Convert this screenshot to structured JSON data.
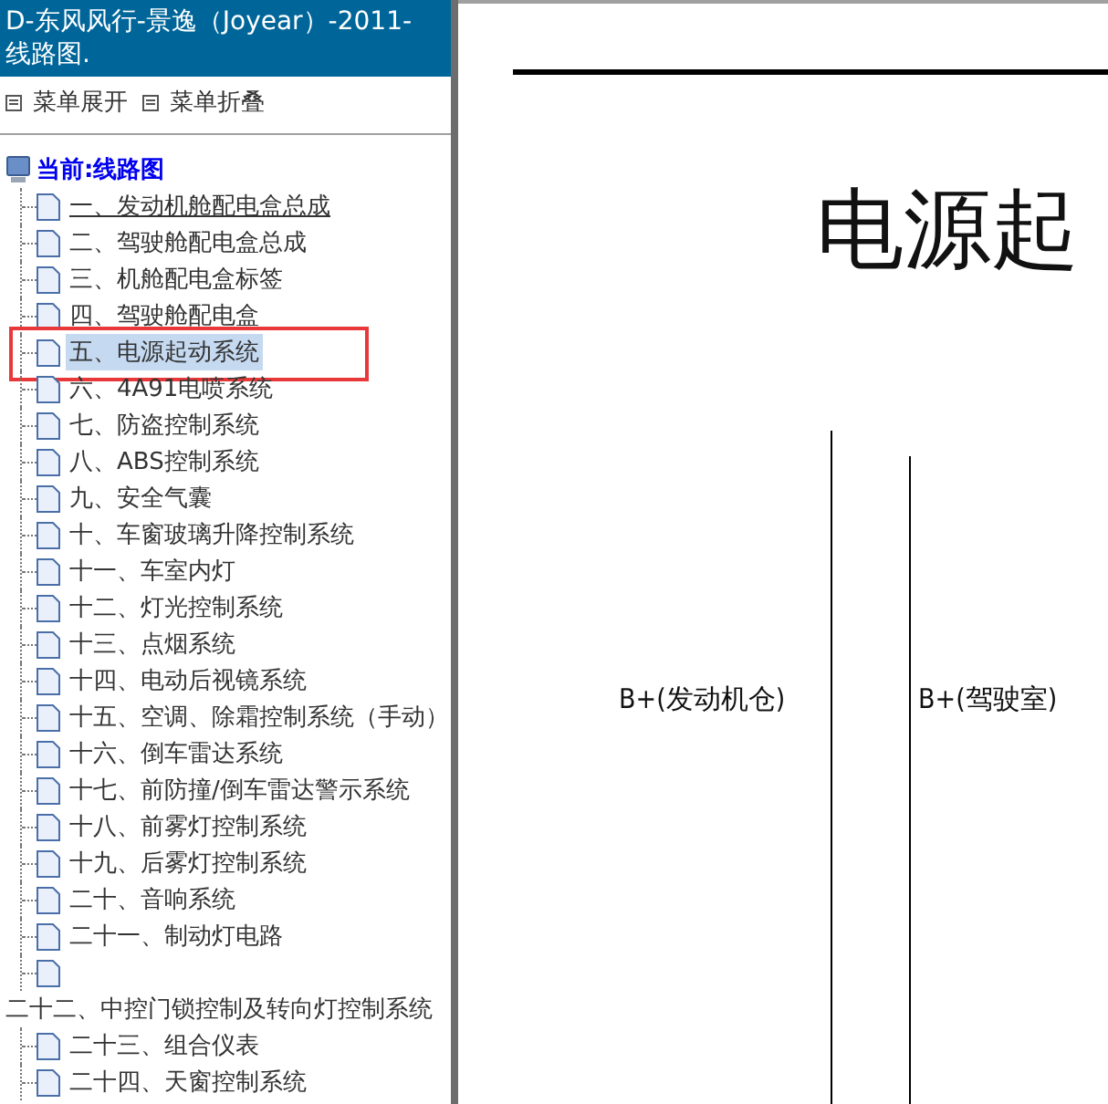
{
  "title": "D-东风风行-景逸（Joyear）-2011- 线路图.",
  "menu": [
    {
      "label": "菜单展开"
    },
    {
      "label": "菜单折叠"
    }
  ],
  "tree": {
    "root": "当前:线路图",
    "items": [
      {
        "kind": "page",
        "label": "一、发动机舱配电盒总成",
        "hovered": true,
        "selected": false,
        "marked": false
      },
      {
        "kind": "page",
        "label": "二、驾驶舱配电盒总成",
        "hovered": false,
        "selected": false,
        "marked": false
      },
      {
        "kind": "page",
        "label": "三、机舱配电盒标签",
        "hovered": false,
        "selected": false,
        "marked": false
      },
      {
        "kind": "page",
        "label": "四、驾驶舱配电盒",
        "hovered": false,
        "selected": false,
        "marked": false
      },
      {
        "kind": "page",
        "label": "五、电源起动系统",
        "hovered": false,
        "selected": true,
        "marked": true
      },
      {
        "kind": "page",
        "label": "六、4A91电喷系统",
        "hovered": false,
        "selected": false,
        "marked": false
      },
      {
        "kind": "page",
        "label": "七、防盗控制系统",
        "hovered": false,
        "selected": false,
        "marked": false
      },
      {
        "kind": "page",
        "label": "八、ABS控制系统",
        "hovered": false,
        "selected": false,
        "marked": false
      },
      {
        "kind": "page",
        "label": "九、安全气囊",
        "hovered": false,
        "selected": false,
        "marked": false
      },
      {
        "kind": "page",
        "label": "十、车窗玻璃升降控制系统",
        "hovered": false,
        "selected": false,
        "marked": false
      },
      {
        "kind": "page",
        "label": "十一、车室内灯",
        "hovered": false,
        "selected": false,
        "marked": false
      },
      {
        "kind": "page",
        "label": "十二、灯光控制系统",
        "hovered": false,
        "selected": false,
        "marked": false
      },
      {
        "kind": "page",
        "label": "十三、点烟系统",
        "hovered": false,
        "selected": false,
        "marked": false
      },
      {
        "kind": "page",
        "label": "十四、电动后视镜系统",
        "hovered": false,
        "selected": false,
        "marked": false
      },
      {
        "kind": "page",
        "label": "十五、空调、除霜控制系统（手动）",
        "hovered": false,
        "selected": false,
        "marked": false
      },
      {
        "kind": "page",
        "label": "十六、倒车雷达系统",
        "hovered": false,
        "selected": false,
        "marked": false
      },
      {
        "kind": "page",
        "label": "十七、前防撞/倒车雷达警示系统",
        "hovered": false,
        "selected": false,
        "marked": false
      },
      {
        "kind": "page",
        "label": "十八、前雾灯控制系统",
        "hovered": false,
        "selected": false,
        "marked": false
      },
      {
        "kind": "page",
        "label": "十九、后雾灯控制系统",
        "hovered": false,
        "selected": false,
        "marked": false
      },
      {
        "kind": "page",
        "label": "二十、音响系统",
        "hovered": false,
        "selected": false,
        "marked": false
      },
      {
        "kind": "page",
        "label": "二十一、制动灯电路",
        "hovered": false,
        "selected": false,
        "marked": false
      },
      {
        "kind": "page",
        "hovered": false,
        "selected": false,
        "marked": false
      },
      {
        "kind": "plain",
        "label": "二十二、中控门锁控制及转向灯控制系统",
        "hovered": false,
        "selected": false,
        "marked": false
      },
      {
        "kind": "page",
        "label": "二十三、组合仪表",
        "hovered": false,
        "selected": false,
        "marked": false
      },
      {
        "kind": "page",
        "label": "二十四、天窗控制系统",
        "hovered": false,
        "selected": false,
        "marked": false
      }
    ]
  },
  "diagram": {
    "title": "电源起",
    "labels": [
      "B+(发动机仓)",
      "B+(驾驶室)"
    ]
  }
}
